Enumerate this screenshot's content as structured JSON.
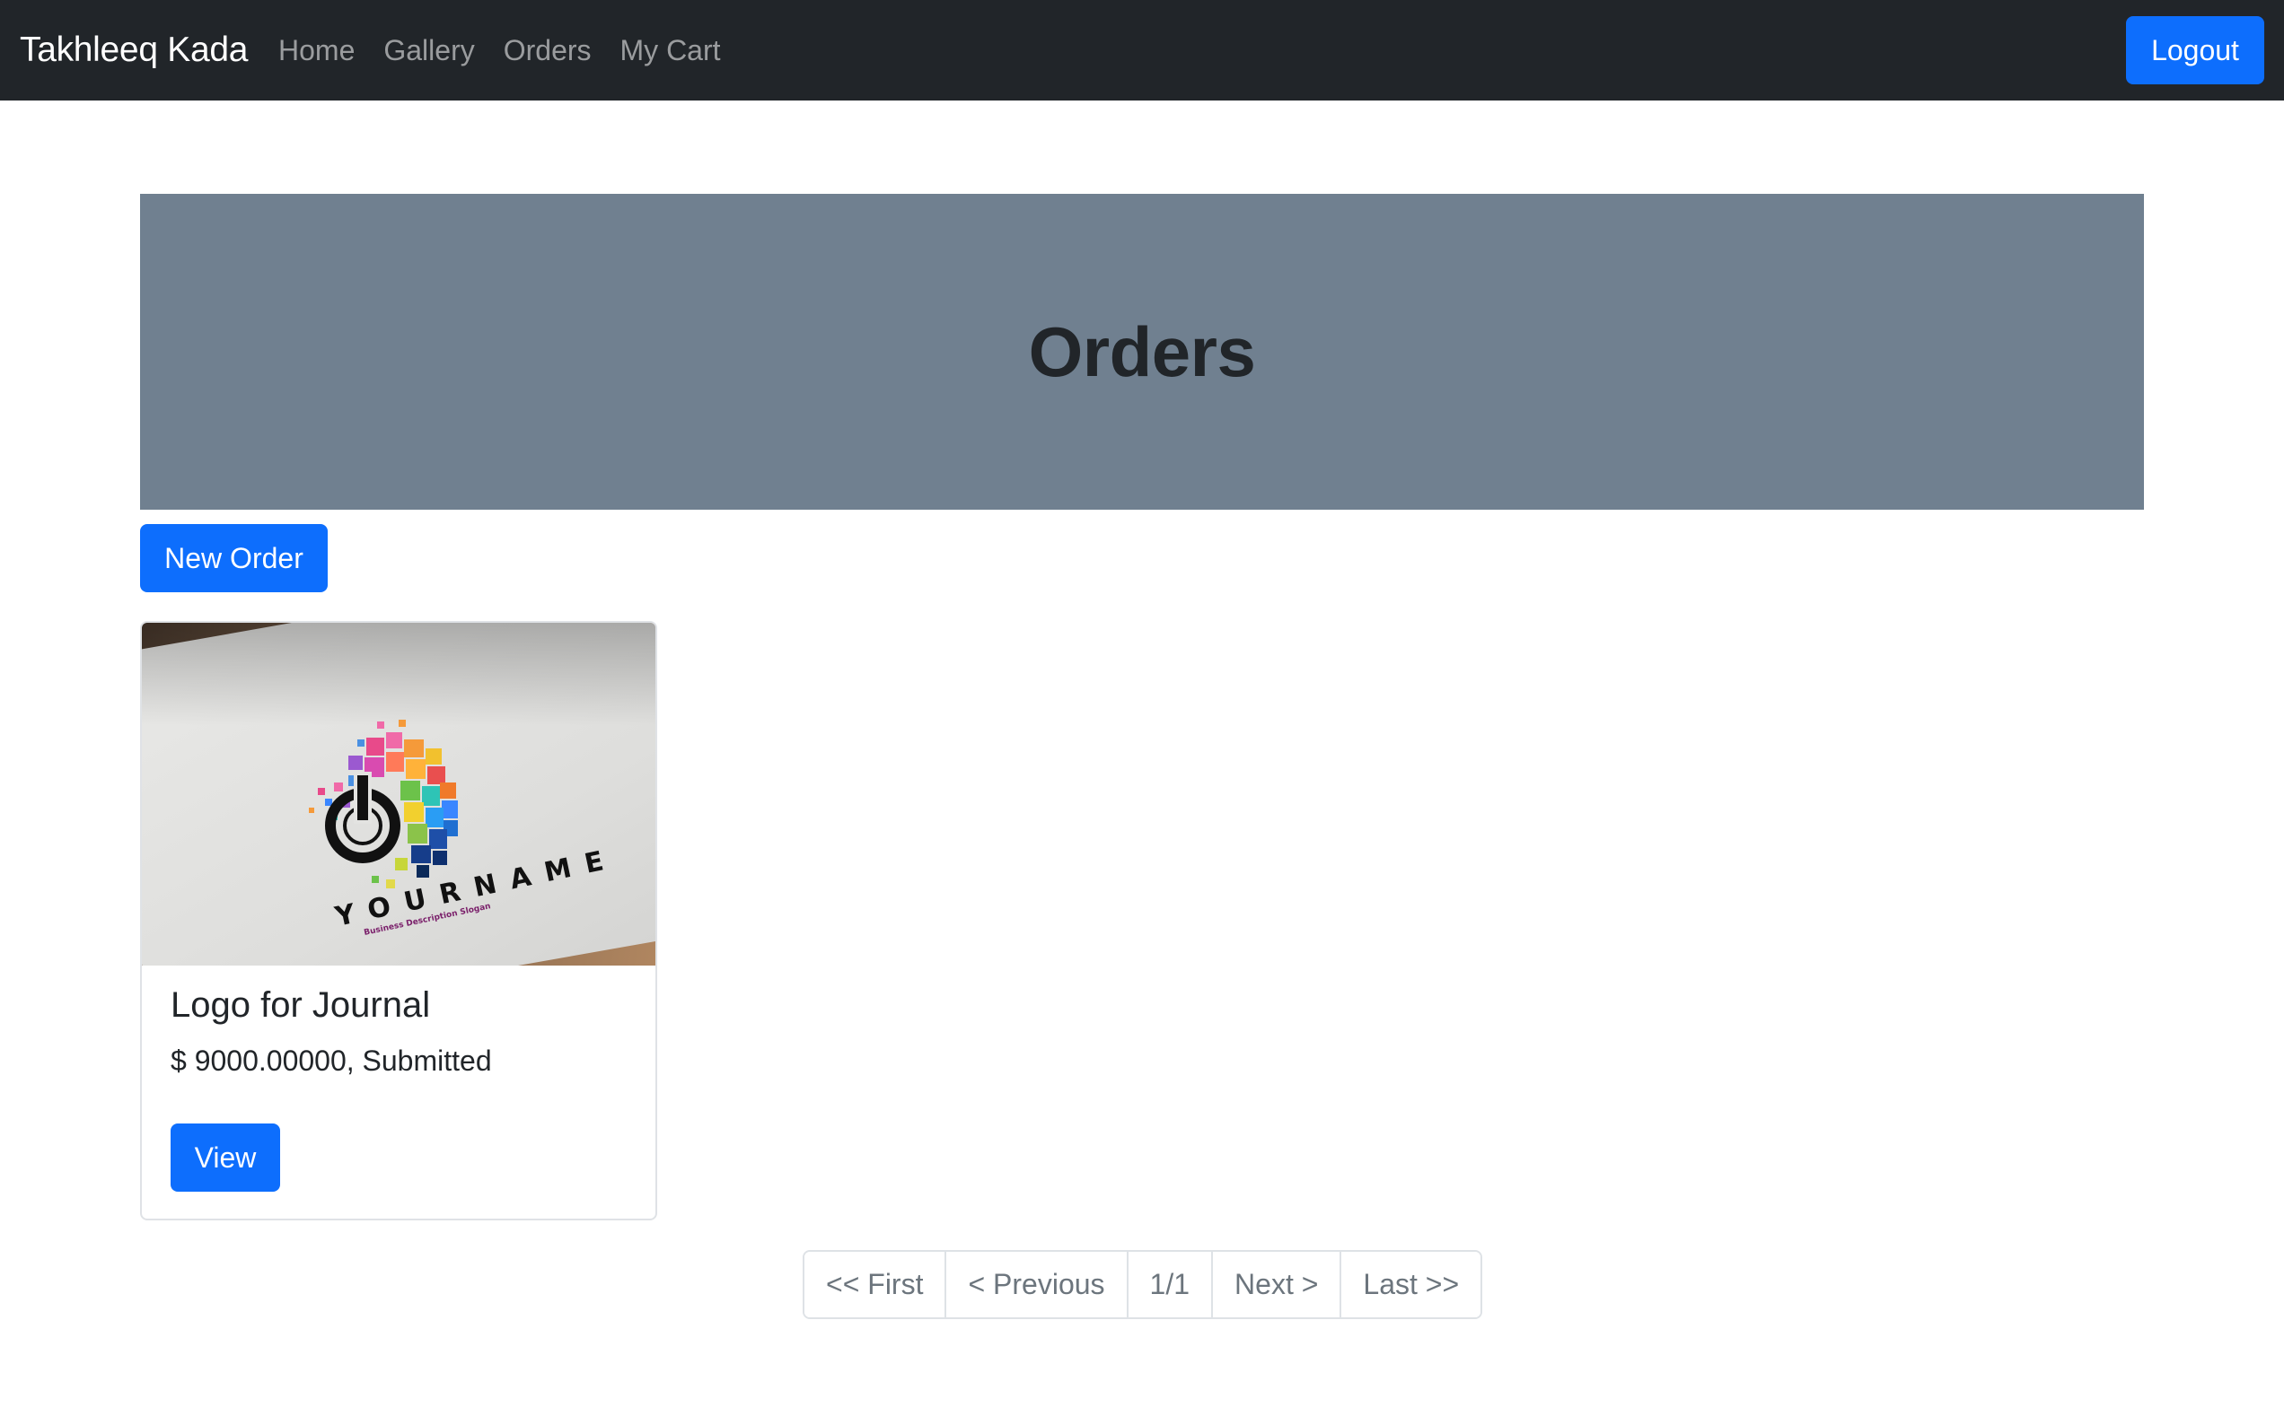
{
  "navbar": {
    "brand": "Takhleeq Kada",
    "links": [
      "Home",
      "Gallery",
      "Orders",
      "My Cart"
    ],
    "logout_label": "Logout"
  },
  "hero": {
    "title": "Orders"
  },
  "actions": {
    "new_order_label": "New Order"
  },
  "orders": [
    {
      "title": "Logo for Journal",
      "details": "$ 9000.00000, Submitted",
      "view_label": "View",
      "image": {
        "logo_text": "YOURNAME",
        "tagline": "Business Description Slogan",
        "icon": "power-icon"
      }
    }
  ],
  "pagination": {
    "first": "<< First",
    "previous": "< Previous",
    "current": "1/1",
    "next": "Next >",
    "last": "Last >>"
  },
  "colors": {
    "navbar_bg": "#212529",
    "primary": "#0d6efd",
    "hero_bg": "#708090"
  }
}
